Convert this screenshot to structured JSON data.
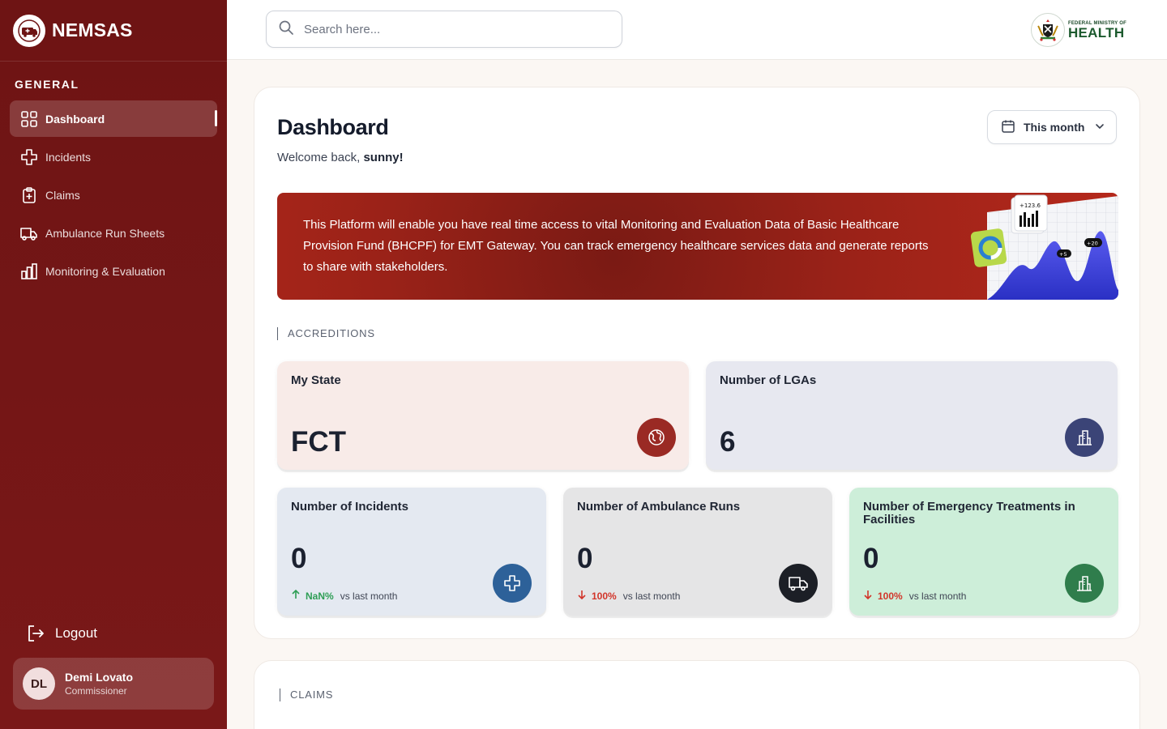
{
  "app": {
    "name": "NEMSAS"
  },
  "sidebar": {
    "section_title": "GENERAL",
    "items": [
      {
        "label": "Dashboard",
        "icon": "grid-icon",
        "active": true
      },
      {
        "label": "Incidents",
        "icon": "medical-cross-icon"
      },
      {
        "label": "Claims",
        "icon": "clipboard-plus-icon"
      },
      {
        "label": "Ambulance Run Sheets",
        "icon": "ambulance-icon"
      },
      {
        "label": "Monitoring & Evaluation",
        "icon": "bar-chart-icon"
      }
    ],
    "logout_label": "Logout",
    "user": {
      "initials": "DL",
      "name": "Demi Lovato",
      "role": "Commissioner"
    }
  },
  "topbar": {
    "search_placeholder": "Search here...",
    "partner": {
      "small": "FEDERAL MINISTRY OF",
      "big": "HEALTH"
    }
  },
  "dashboard": {
    "title": "Dashboard",
    "welcome_prefix": "Welcome back, ",
    "user_first_name": "sunny!",
    "period": "This month",
    "banner_text": "This Platform will enable you have real time access to vital Monitoring and Evaluation Data of Basic Healthcare Provision Fund (BHCPF) for EMT Gateway. You can track emergency healthcare services data and generate reports to share with stakeholders.",
    "banner_art_labels": [
      "+123.6",
      "+5",
      "+20"
    ],
    "accreditations_label": "ACCREDITIONS",
    "cards": {
      "state": {
        "title": "My State",
        "value": "FCT",
        "icon": "globe-icon"
      },
      "lgas": {
        "title": "Number of LGAs",
        "value": "6",
        "icon": "building-icon"
      },
      "incidents": {
        "title": "Number of Incidents",
        "value": "0",
        "trend": "NaN%",
        "trend_dir": "up",
        "trend_suffix": "vs last month",
        "icon": "medical-cross-icon"
      },
      "ambulance": {
        "title": "Number of Ambulance Runs",
        "value": "0",
        "trend": "100%",
        "trend_dir": "down",
        "trend_suffix": "vs last month",
        "icon": "truck-icon"
      },
      "treatments": {
        "title": "Number of Emergency Treatments in Facilities",
        "value": "0",
        "trend": "100%",
        "trend_dir": "down",
        "trend_suffix": "vs last month",
        "icon": "building-icon"
      }
    },
    "claims_label": "CLAIMS"
  },
  "colors": {
    "sidebar": "#6e1414",
    "accent_red": "#9a2a24",
    "navy": "#3b4477",
    "blue": "#2d6199",
    "dark": "#1c1f26",
    "green": "#2f7d4c"
  }
}
